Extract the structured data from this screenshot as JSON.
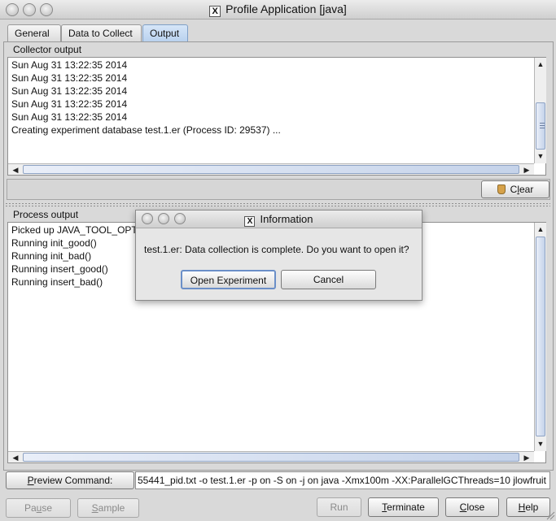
{
  "window": {
    "title": "Profile Application [java]"
  },
  "tabs": [
    {
      "label": "General"
    },
    {
      "label": "Data to Collect"
    },
    {
      "label": "Output"
    }
  ],
  "collector": {
    "label": "Collector output",
    "lines": [
      "Sun Aug 31 13:22:35 2014",
      "Sun Aug 31 13:22:35 2014",
      "Sun Aug 31 13:22:35 2014",
      "Sun Aug 31 13:22:35 2014",
      "Sun Aug 31 13:22:35 2014",
      "Creating experiment database test.1.er (Process ID: 29537) ..."
    ]
  },
  "clear_button": {
    "prefix": "C",
    "underlined": "l",
    "suffix": "ear"
  },
  "process": {
    "label": "Process output",
    "lines": [
      "Picked up JAVA_TOOL_OPT",
      "Running init_good()",
      "Running init_bad()",
      "Running insert_good()",
      "Running insert_bad()"
    ]
  },
  "preview": {
    "button_underlined": "P",
    "button_rest": "review Command:",
    "command": "55441_pid.txt -o test.1.er -p on -S on -j on java -Xmx100m -XX:ParallelGCThreads=10 jlowfruit"
  },
  "bottom_buttons": {
    "pause": {
      "prefix": "Pa",
      "u": "u",
      "suffix": "se"
    },
    "sample": {
      "u": "S",
      "suffix": "ample"
    },
    "run": "Run",
    "terminate": {
      "u": "T",
      "suffix": "erminate"
    },
    "close": {
      "u": "C",
      "suffix": "lose"
    },
    "help": {
      "u": "H",
      "suffix": "elp"
    }
  },
  "dialog": {
    "title": "Information",
    "message": "test.1.er: Data collection is complete. Do you want to open it?",
    "open_label": "Open Experiment",
    "cancel_label": "Cancel"
  }
}
